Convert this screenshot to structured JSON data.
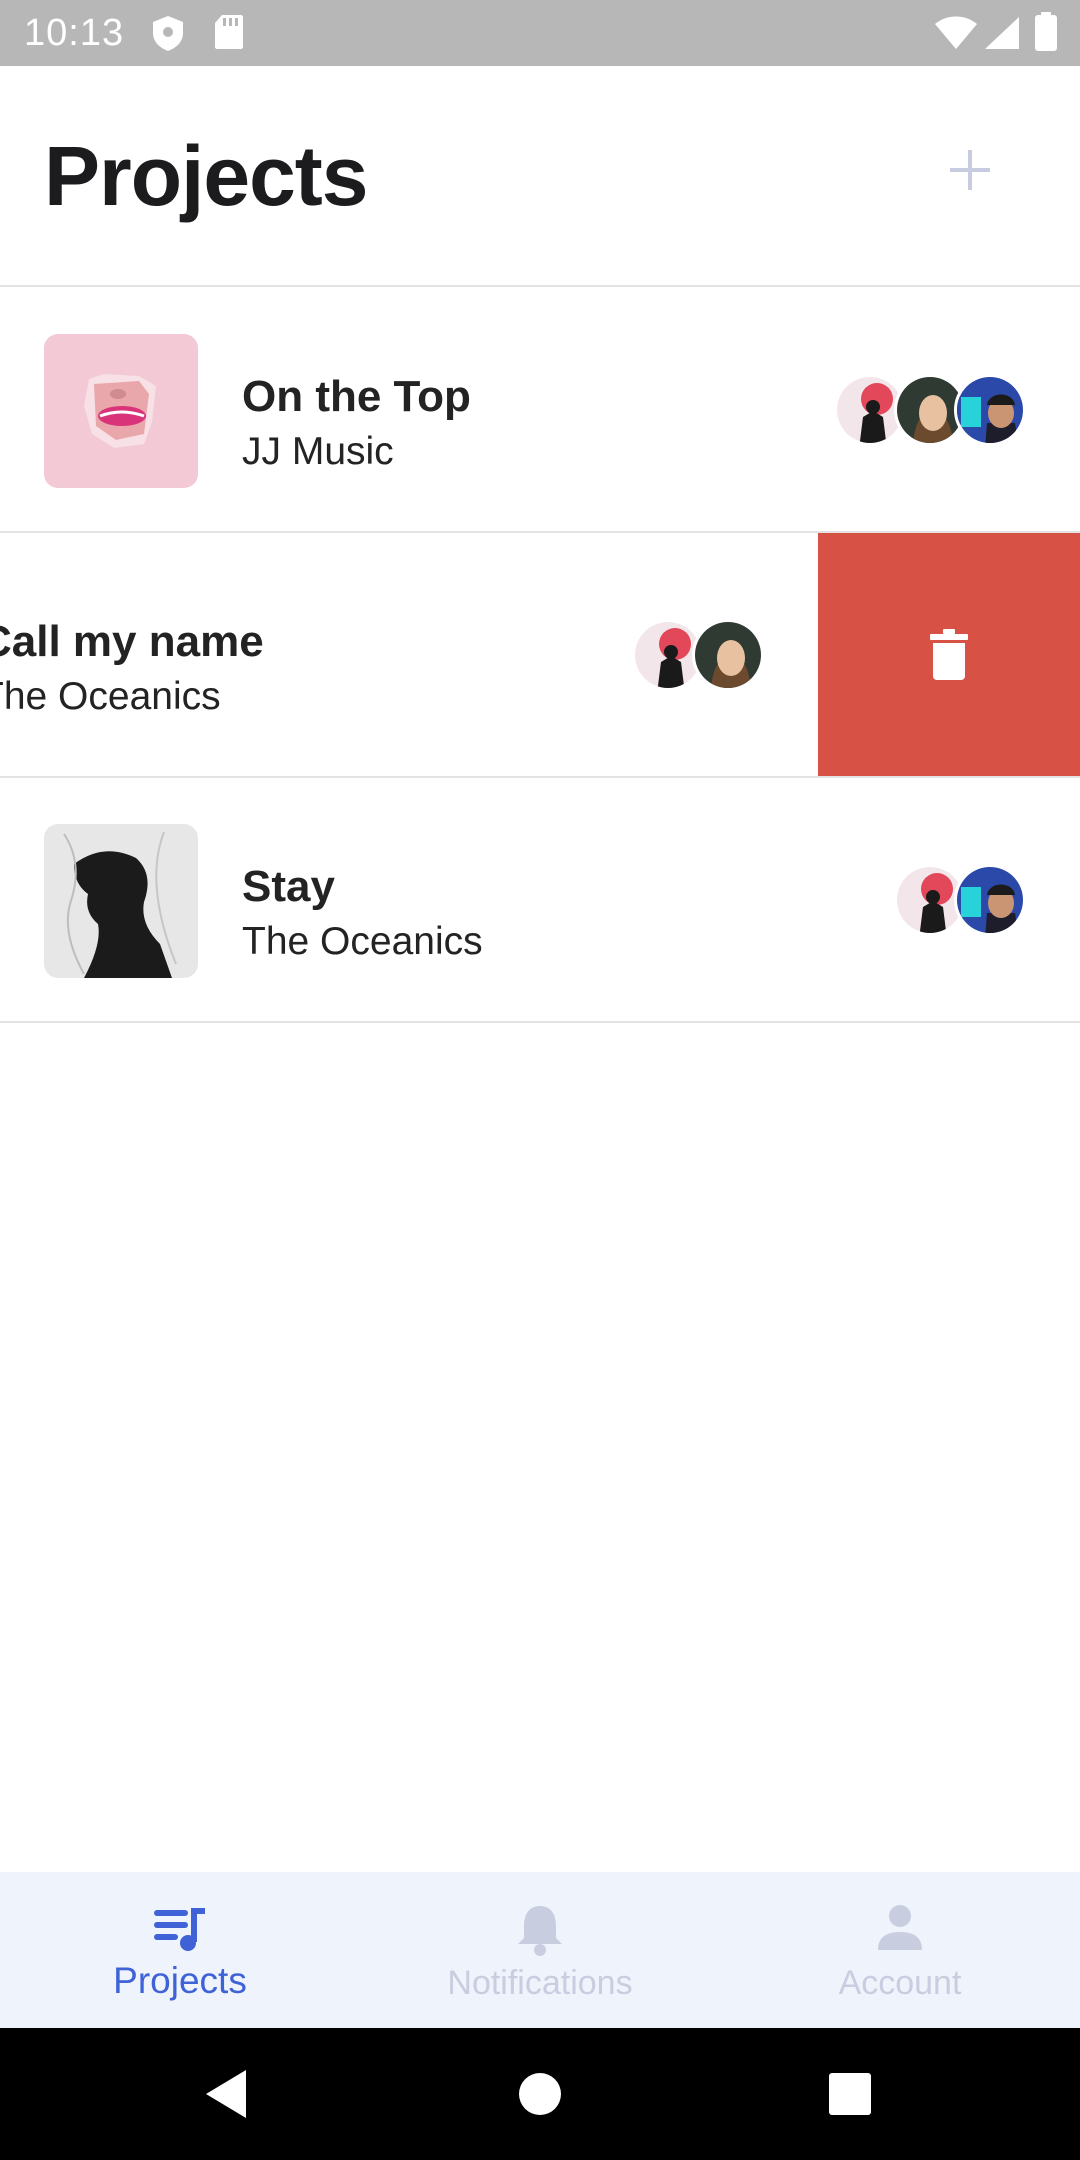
{
  "status_bar": {
    "time": "10:13",
    "left_icons": [
      "shield-icon",
      "sd-card-icon"
    ],
    "right_icons": [
      "wifi-icon",
      "signal-icon",
      "battery-icon"
    ]
  },
  "header": {
    "title": "Projects",
    "add_icon": "plus-icon"
  },
  "projects": [
    {
      "title": "On the Top",
      "artist": "JJ Music",
      "cover": "pink-lips-cover",
      "collaborators": [
        "red-smoke-avatar",
        "woman-avatar",
        "neon-man-avatar"
      ],
      "swiped": false
    },
    {
      "title": "Call my name",
      "artist": "The Oceanics",
      "cover": "hidden",
      "collaborators": [
        "red-smoke-avatar",
        "woman-avatar"
      ],
      "swiped": true,
      "action": "delete"
    },
    {
      "title": "Stay",
      "artist": "The Oceanics",
      "cover": "silhouette-cover",
      "collaborators": [
        "red-smoke-avatar",
        "neon-man-avatar"
      ],
      "swiped": false
    }
  ],
  "bottom_nav": {
    "items": [
      {
        "label": "Projects",
        "icon": "playlist-music-icon",
        "active": true
      },
      {
        "label": "Notifications",
        "icon": "bell-icon",
        "active": false
      },
      {
        "label": "Account",
        "icon": "person-icon",
        "active": false
      }
    ]
  },
  "colors": {
    "accent": "#3f62d7",
    "delete": "#d75244",
    "nav_background": "#eef3fc",
    "inactive": "#c9cde0",
    "status_bar": "#b7b7b7"
  }
}
